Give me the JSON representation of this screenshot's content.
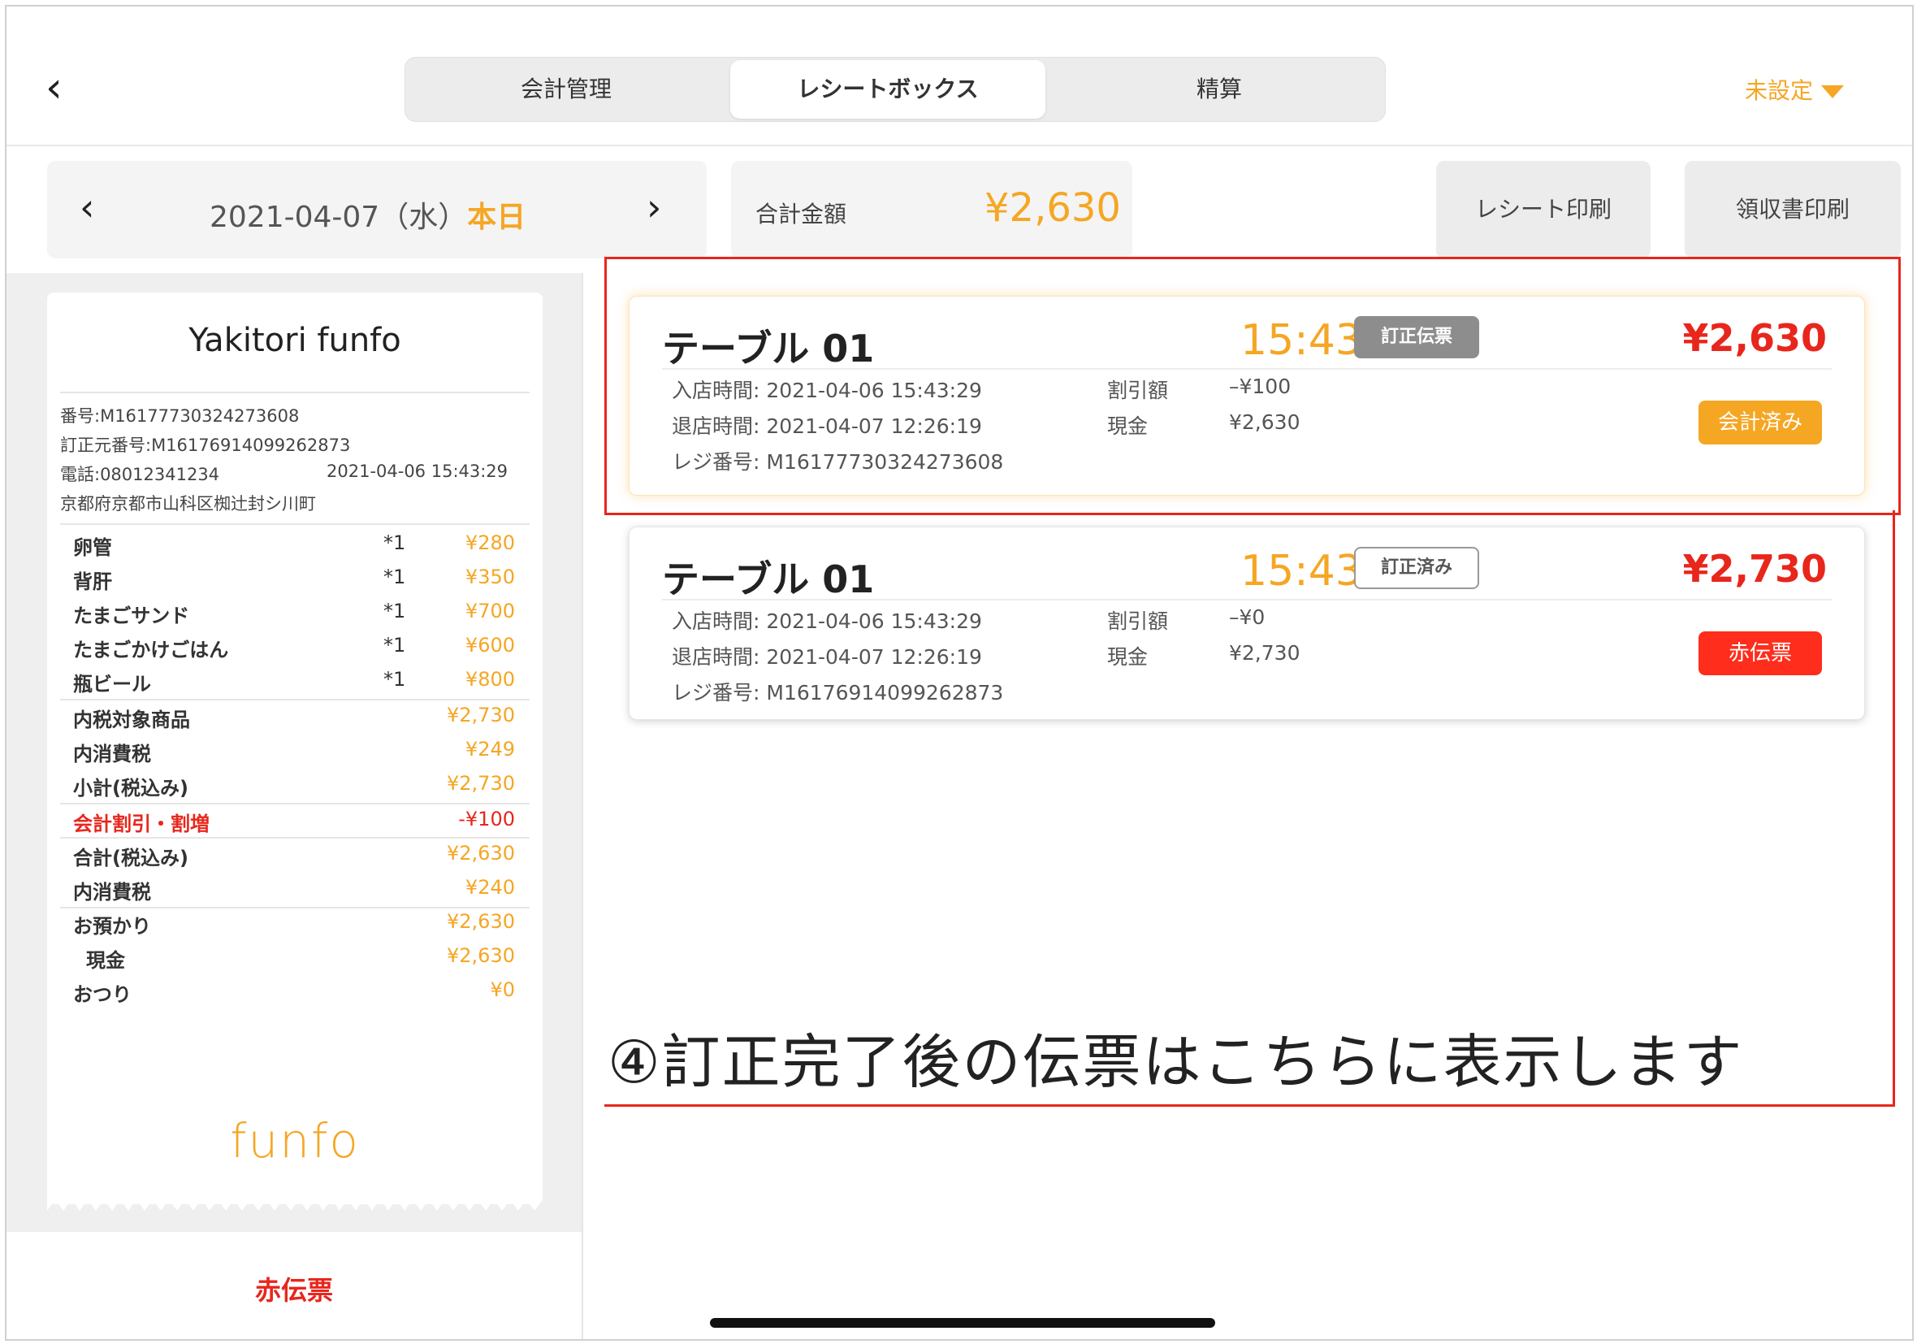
{
  "header": {
    "tabs": [
      {
        "label": "会計管理",
        "active": false
      },
      {
        "label": "レシートボックス",
        "active": true
      },
      {
        "label": "精算",
        "active": false
      }
    ],
    "status_dropdown": "未設定",
    "icons": {
      "back": "chevron-left-icon",
      "dropdown": "caret-down-icon"
    }
  },
  "datebar": {
    "date": "2021-04-07（水）",
    "today": "本日"
  },
  "total": {
    "label": "合計金額",
    "value": "¥2,630"
  },
  "actions": {
    "receipt_print": "レシート印刷",
    "invoice_print": "領収書印刷"
  },
  "receipt": {
    "store_name": "Yakitori funfo",
    "number": "番号:M16177730324273608",
    "original_number": "訂正元番号:M16176914099262873",
    "phone": "電話:08012341234",
    "datetime": "2021-04-06 15:43:29",
    "address": "京都府京都市山科区椥辻封シ川町",
    "items": [
      {
        "name": "卵管",
        "qty": "*1",
        "price": "¥280"
      },
      {
        "name": "背肝",
        "qty": "*1",
        "price": "¥350"
      },
      {
        "name": "たまごサンド",
        "qty": "*1",
        "price": "¥700"
      },
      {
        "name": "たまごかけごはん",
        "qty": "*1",
        "price": "¥600"
      },
      {
        "name": "瓶ビール",
        "qty": "*1",
        "price": "¥800"
      }
    ],
    "summary": [
      {
        "name": "内税対象商品",
        "price": "¥2,730"
      },
      {
        "name": "内消費税",
        "price": "¥249"
      },
      {
        "name": "小計(税込み)",
        "price": "¥2,730"
      }
    ],
    "discount": {
      "name": "会計割引・割増",
      "price": "-¥100"
    },
    "totals": [
      {
        "name": "合計(税込み)",
        "price": "¥2,630"
      },
      {
        "name": "内消費税",
        "price": "¥240"
      }
    ],
    "payments": [
      {
        "name": "お預かり",
        "price": "¥2,630"
      },
      {
        "name": "現金",
        "price": "¥2,630"
      },
      {
        "name": "おつり",
        "price": "¥0"
      }
    ],
    "logo": "funfo"
  },
  "left_footer_button": "赤伝票",
  "cards": [
    {
      "title": "テーブル 01",
      "time": "15:43",
      "badge": "訂正伝票",
      "amount": "¥2,630",
      "in_time": "入店時間:  2021-04-06 15:43:29",
      "out_time": "退店時間:  2021-04-07 12:26:19",
      "register": "レジ番号: M16177730324273608",
      "discount_label": "割引額",
      "discount_value": "–¥100",
      "cash_label": "現金",
      "cash_value": "¥2,630",
      "button": "会計済み"
    },
    {
      "title": "テーブル 01",
      "time": "15:43",
      "badge": "訂正済み",
      "amount": "¥2,730",
      "in_time": "入店時間:  2021-04-06 15:43:29",
      "out_time": "退店時間:  2021-04-07 12:26:19",
      "register": "レジ番号: M16176914099262873",
      "discount_label": "割引額",
      "discount_value": "–¥0",
      "cash_label": "現金",
      "cash_value": "¥2,730",
      "button": "赤伝票"
    }
  ],
  "annotation": "④訂正完了後の伝票はこちらに表示します",
  "colors": {
    "accent": "#f5a623",
    "red": "#e8261c",
    "button_red": "#ff2d1c"
  }
}
